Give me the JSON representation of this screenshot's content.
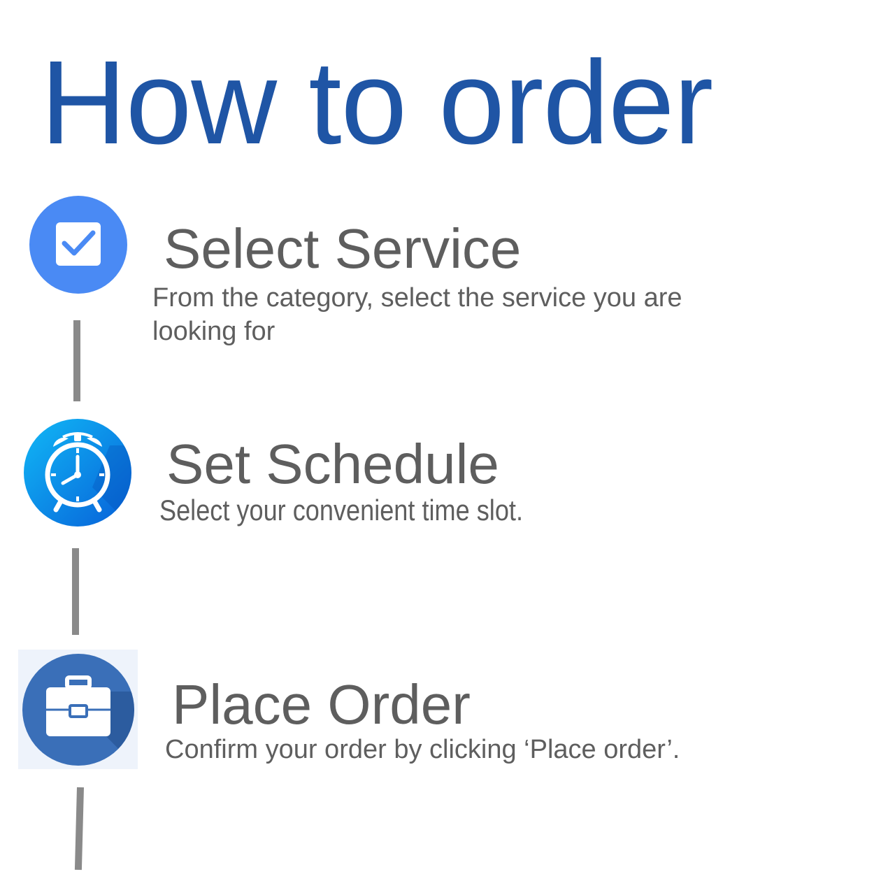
{
  "page": {
    "title": "How to order",
    "title_color": "#1f55a5"
  },
  "steps": [
    {
      "icon": "checkbox-icon",
      "icon_color": "#4a8af4",
      "title": "Select Service",
      "description": "From the category, select the service you are looking for"
    },
    {
      "icon": "alarm-clock-icon",
      "icon_color": "#0a8fe8",
      "title": "Set Schedule",
      "description": "Select your convenient time slot."
    },
    {
      "icon": "briefcase-icon",
      "icon_color": "#3a6fb8",
      "title": "Place Order",
      "description": "Confirm your order by clicking ‘Place order’."
    }
  ]
}
